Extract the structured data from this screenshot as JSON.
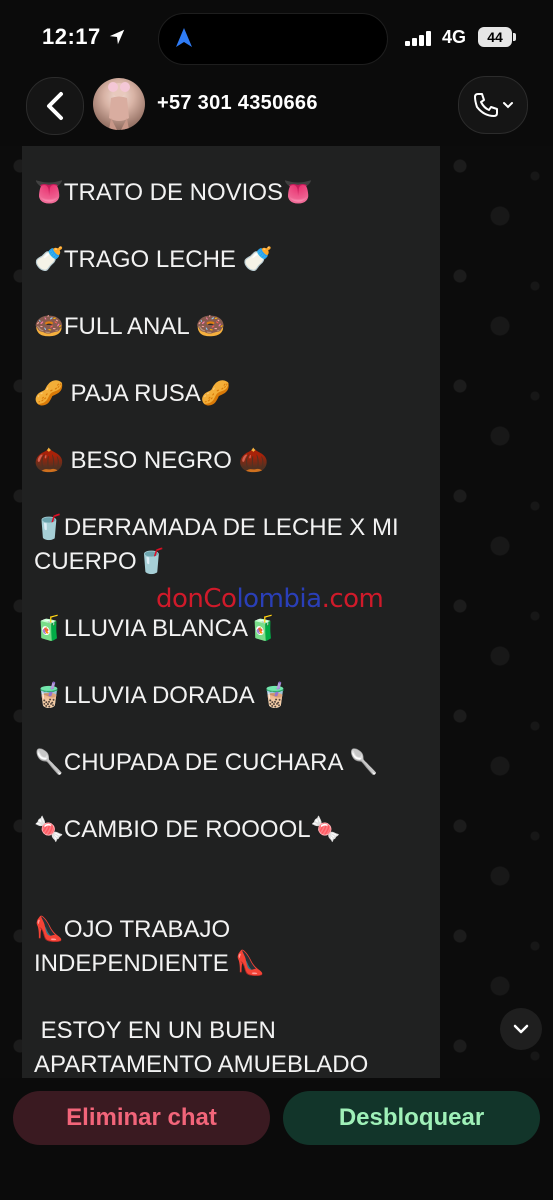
{
  "status_bar": {
    "time": "12:17",
    "network": "4G",
    "battery": "44"
  },
  "header": {
    "contact": "+57 301 4350666"
  },
  "message_lines": [
    "👅TRATO DE NOVIOS👅",
    "🍼TRAGO LECHE 🍼",
    "🍩FULL ANAL 🍩",
    "🥜 PAJA RUSA🥜",
    "🌰 BESO NEGRO 🌰",
    "🥤DERRAMADA DE LECHE X MI\nCUERPO🥤",
    "🧃LLUVIA BLANCA🧃",
    "🧋LLUVIA DORADA 🧋",
    "🥄CHUPADA DE CUCHARA 🥄",
    "🍬CAMBIO DE ROOOOL🍬",
    "👠OJO TRABAJO\nINDEPENDIENTE 👠",
    " ESTOY EN UN BUEN\nAPARTAMENTO AMUEBLADO"
  ],
  "watermark": {
    "part1": "donCo",
    "part2": "lombia",
    "part3": ".com"
  },
  "actions": {
    "delete": "Eliminar chat",
    "unblock": "Desbloquear"
  }
}
